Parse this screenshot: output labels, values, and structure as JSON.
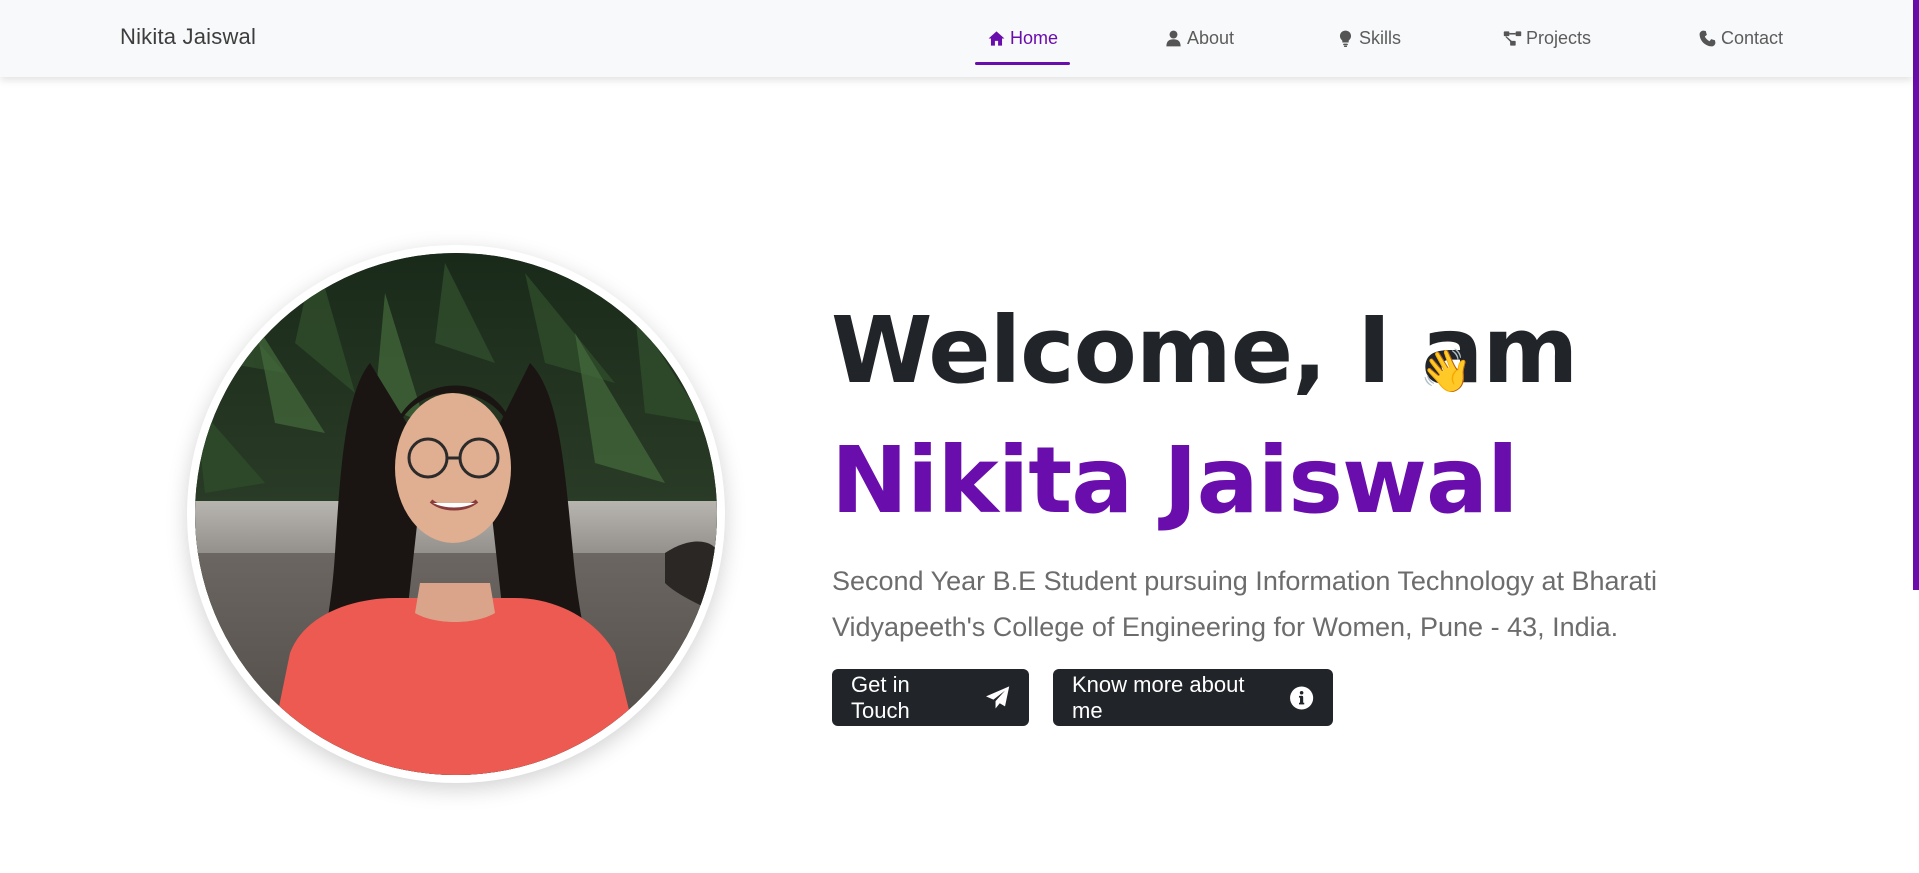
{
  "navbar": {
    "brand": "Nikita Jaiswal",
    "items": [
      {
        "label": "Home",
        "icon": "home-icon",
        "active": true
      },
      {
        "label": "About",
        "icon": "user-icon",
        "active": false
      },
      {
        "label": "Skills",
        "icon": "lightbulb-icon",
        "active": false
      },
      {
        "label": "Projects",
        "icon": "project-diagram-icon",
        "active": false
      },
      {
        "label": "Contact",
        "icon": "phone-icon",
        "active": false
      }
    ]
  },
  "hero": {
    "greeting": "Welcome, I am",
    "emoji": "👋",
    "name": "Nikita Jaiswal",
    "tagline": "Second Year B.E Student pursuing Information Technology at Bharati Vidyapeeth's College of Engineering for Women, Pune - 43, India.",
    "buttons": [
      {
        "label": "Get in Touch",
        "icon": "paper-plane-icon"
      },
      {
        "label": "Know more about me",
        "icon": "info-circle-icon"
      }
    ]
  },
  "colors": {
    "accent": "#6a0dad",
    "dark": "#212529",
    "navbar_bg": "#f8f9fa",
    "text_muted": "#6c6c6c"
  }
}
